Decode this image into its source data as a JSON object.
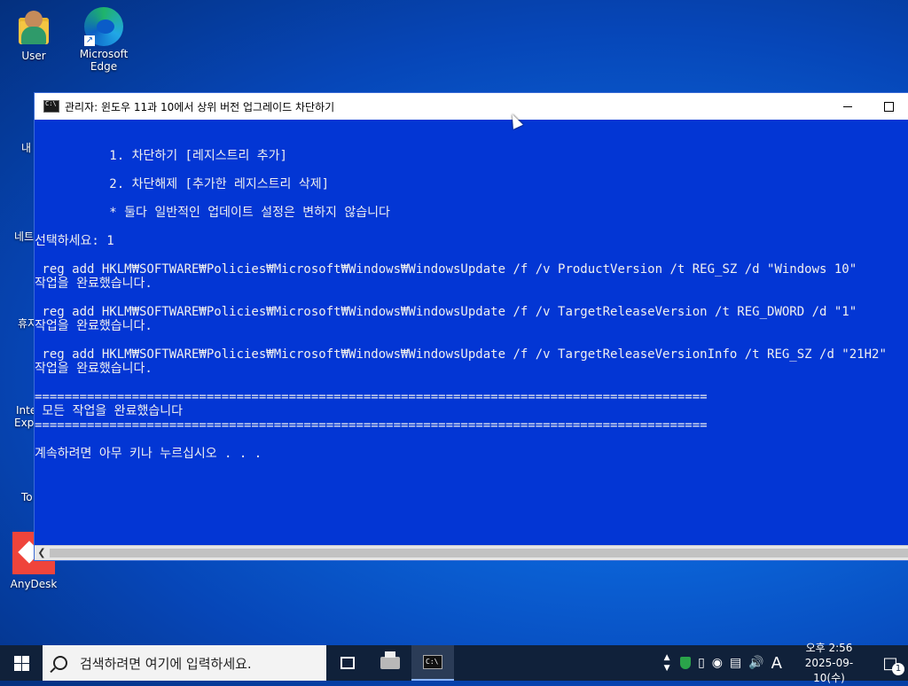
{
  "desktop": {
    "icons": [
      {
        "label": "User"
      },
      {
        "label": "Microsoft Edge"
      },
      {
        "label": "AnyDesk"
      }
    ],
    "partial_labels": [
      "내",
      "네트",
      "휴지",
      "Inte",
      "Expl",
      "To"
    ]
  },
  "window": {
    "title": "관리자:  윈도우 11과 10에서 상위 버전 업그레이드 차단하기",
    "lines": [
      "          1. 차단하기 [레지스트리 추가]",
      "          2. 차단해제 [추가한 레지스트리 삭제]",
      "          * 둘다 일반적인 업데이트 설정은 변하지 않습니다",
      "선택하세요: 1",
      " reg add HKLM₩SOFTWARE₩Policies₩Microsoft₩Windows₩WindowsUpdate /f /v ProductVersion /t REG_SZ /d \"Windows 10\"",
      "작업을 완료했습니다.",
      " reg add HKLM₩SOFTWARE₩Policies₩Microsoft₩Windows₩WindowsUpdate /f /v TargetReleaseVersion /t REG_DWORD /d \"1\"",
      "작업을 완료했습니다.",
      " reg add HKLM₩SOFTWARE₩Policies₩Microsoft₩Windows₩WindowsUpdate /f /v TargetReleaseVersionInfo /t REG_SZ /d \"21H2\"",
      "작업을 완료했습니다.",
      "==========================================================================================",
      " 모든 작업을 완료했습니다",
      "==========================================================================================",
      "계속하려면 아무 키나 누르십시오 . . ."
    ],
    "colors": {
      "console_bg": "#0336d4",
      "console_fg": "#f0f0f0"
    }
  },
  "taskbar": {
    "search_placeholder": "검색하려면 여기에 입력하세요.",
    "tray": {
      "ime_label": "A",
      "time": "오후 2:56",
      "date": "2025-09-10(수)",
      "notification_count": "1"
    }
  }
}
